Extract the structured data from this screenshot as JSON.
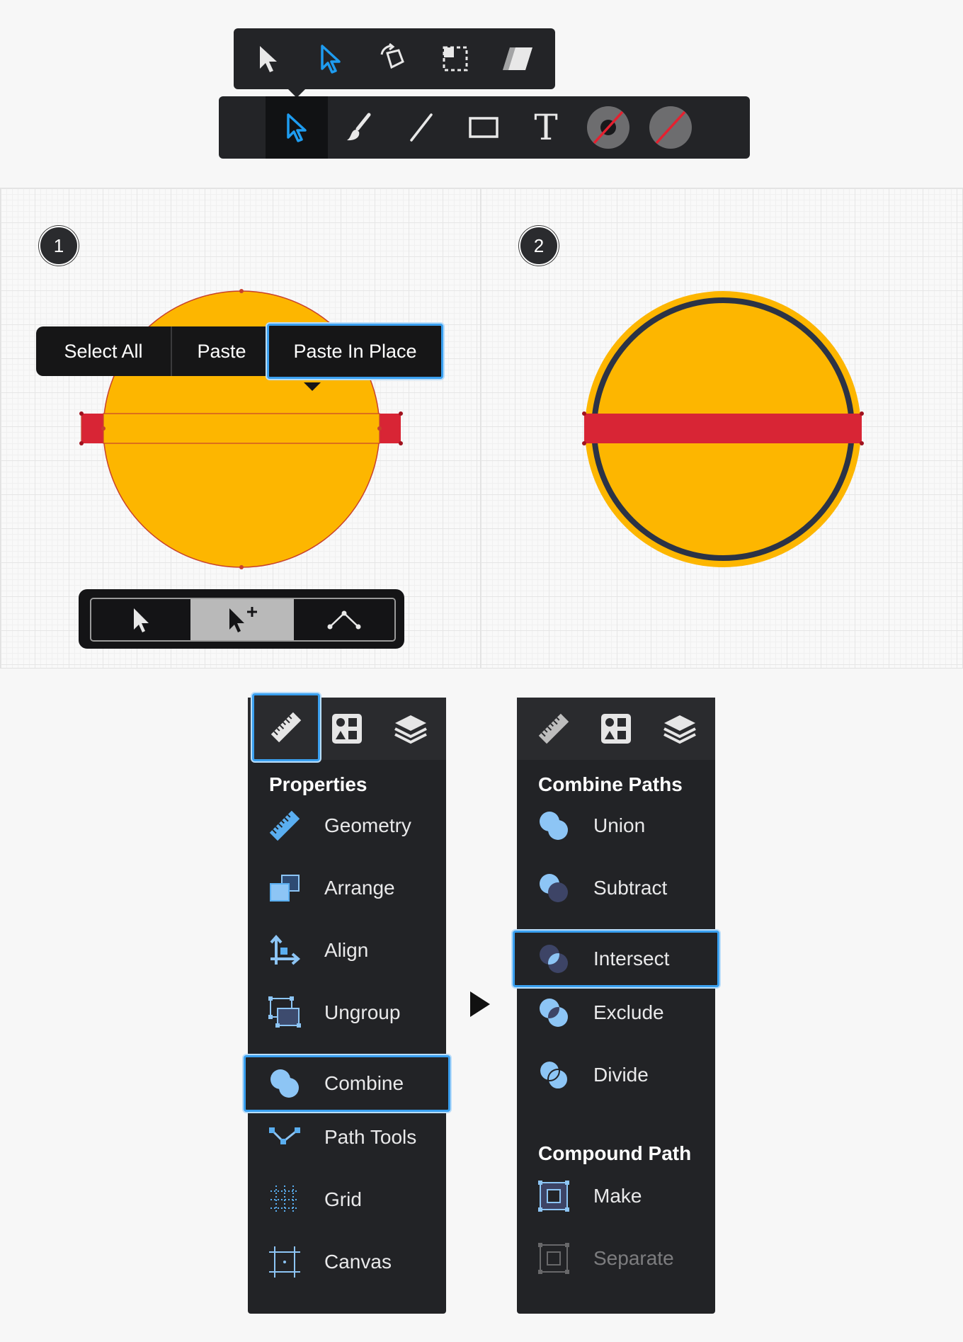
{
  "colors": {
    "accent": "#3aa0f0",
    "dark_panel": "#222326",
    "shape_fill": "#fdb600",
    "band_fill": "#d82535",
    "stroke_navy": "#2b3346"
  },
  "top_toolbar": {
    "flyout_tools": [
      "selection-arrow-icon",
      "direct-selection-arrow-icon",
      "rotate-tool-icon",
      "scale-tool-icon",
      "skew-tool-icon"
    ],
    "main_tools": [
      "selection-arrow-icon",
      "brush-icon",
      "line-icon",
      "rectangle-icon",
      "text-icon",
      "stroke-color-icon",
      "fill-color-icon"
    ],
    "text_tool_glyph": "T"
  },
  "canvas_left": {
    "step": "1",
    "context_menu": {
      "select_all": "Select All",
      "paste": "Paste",
      "paste_in_place": "Paste In Place"
    },
    "selection_modes": [
      "selection-arrow-icon",
      "add-selection-arrow-icon",
      "path-node-icon"
    ]
  },
  "canvas_right": {
    "step": "2"
  },
  "properties_panel": {
    "tabs": [
      "ruler-icon",
      "shapes-icon",
      "layers-icon"
    ],
    "title": "Properties",
    "items": [
      {
        "label": "Geometry",
        "icon": "ruler-icon"
      },
      {
        "label": "Arrange",
        "icon": "arrange-icon"
      },
      {
        "label": "Align",
        "icon": "align-icon"
      },
      {
        "label": "Ungroup",
        "icon": "ungroup-icon"
      },
      {
        "label": "Combine",
        "icon": "combine-icon",
        "selected": true
      },
      {
        "label": "Path Tools",
        "icon": "path-tools-icon"
      },
      {
        "label": "Grid",
        "icon": "grid-icon"
      },
      {
        "label": "Canvas",
        "icon": "canvas-icon"
      }
    ]
  },
  "arrow_icon": "play-arrow-icon",
  "combine_panel": {
    "tabs": [
      "ruler-icon",
      "shapes-icon",
      "layers-icon"
    ],
    "title": "Combine Paths",
    "items": [
      {
        "label": "Union",
        "icon": "union-icon"
      },
      {
        "label": "Subtract",
        "icon": "subtract-icon"
      },
      {
        "label": "Intersect",
        "icon": "intersect-icon",
        "selected": true
      },
      {
        "label": "Exclude",
        "icon": "exclude-icon"
      },
      {
        "label": "Divide",
        "icon": "divide-icon"
      }
    ],
    "subtitle": "Compound Path",
    "compound_items": [
      {
        "label": "Make",
        "icon": "make-compound-icon"
      },
      {
        "label": "Separate",
        "icon": "separate-compound-icon",
        "disabled": true
      }
    ]
  }
}
